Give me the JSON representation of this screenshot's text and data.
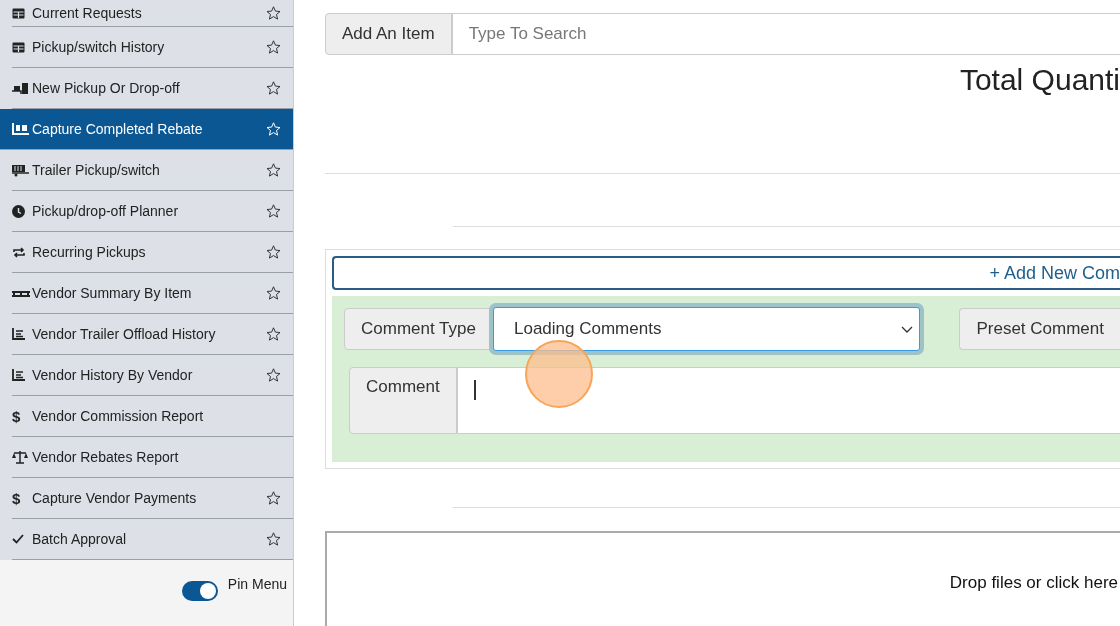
{
  "sidebar": {
    "items": [
      {
        "label": "Current Requests",
        "kind": "grid",
        "starred": true,
        "selected": false
      },
      {
        "label": "Pickup/switch History",
        "kind": "grid",
        "starred": true,
        "selected": false
      },
      {
        "label": "New Pickup Or Drop-off",
        "kind": "dolly",
        "starred": true,
        "selected": false
      },
      {
        "label": "Capture Completed Rebate",
        "kind": "cart",
        "starred": true,
        "selected": true
      },
      {
        "label": "Trailer Pickup/switch",
        "kind": "trailer",
        "starred": true,
        "selected": false
      },
      {
        "label": "Pickup/drop-off Planner",
        "kind": "clock",
        "starred": true,
        "selected": false
      },
      {
        "label": "Recurring Pickups",
        "kind": "repeat",
        "starred": true,
        "selected": false
      },
      {
        "label": "Vendor Summary By Item",
        "kind": "pallet",
        "starred": true,
        "selected": false
      },
      {
        "label": "Vendor Trailer Offload History",
        "kind": "chart",
        "starred": true,
        "selected": false
      },
      {
        "label": "Vendor History By Vendor",
        "kind": "chart",
        "starred": true,
        "selected": false
      },
      {
        "label": "Vendor Commission Report",
        "kind": "glyph",
        "glyph": "$",
        "starred": false,
        "selected": false
      },
      {
        "label": "Vendor Rebates Report",
        "kind": "scale",
        "starred": false,
        "selected": false
      },
      {
        "label": "Capture Vendor Payments",
        "kind": "glyph",
        "glyph": "$",
        "starred": true,
        "selected": false
      },
      {
        "label": "Batch Approval",
        "kind": "check",
        "starred": true,
        "selected": false
      }
    ],
    "pin_menu": {
      "label": "Pin Menu",
      "on": true
    }
  },
  "item_search": {
    "addon": "Add An Item",
    "placeholder": "Type To Search"
  },
  "total_heading": "Total Quanti",
  "comments": {
    "add_button": "+ Add New Com",
    "comment_type": {
      "label": "Comment Type",
      "value": "Loading Comments"
    },
    "preset": {
      "label": "Preset Comment"
    },
    "comment": {
      "label": "Comment"
    }
  },
  "dropzone": {
    "text": "Drop files or click here"
  }
}
